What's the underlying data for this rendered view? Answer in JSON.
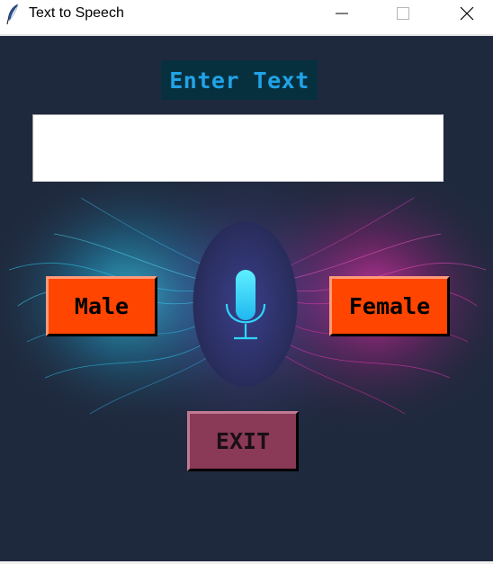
{
  "window": {
    "title": "Text to Speech",
    "icon": "feather-icon",
    "controls": [
      "minimize-icon",
      "maximize-icon",
      "close-icon"
    ]
  },
  "main": {
    "heading": "Enter Text",
    "text_input": {
      "value": "",
      "placeholder": ""
    },
    "buttons": {
      "male": "Male",
      "female": "Female",
      "exit": "EXIT"
    },
    "center_icon": "microphone-icon"
  },
  "colors": {
    "background": "#1f293d",
    "heading_bg": "#07303f",
    "heading_text": "#21a3e6",
    "voice_button": "#ff4500",
    "exit_button": "#8a3a56",
    "mic_glow": "#2fd6ff"
  }
}
